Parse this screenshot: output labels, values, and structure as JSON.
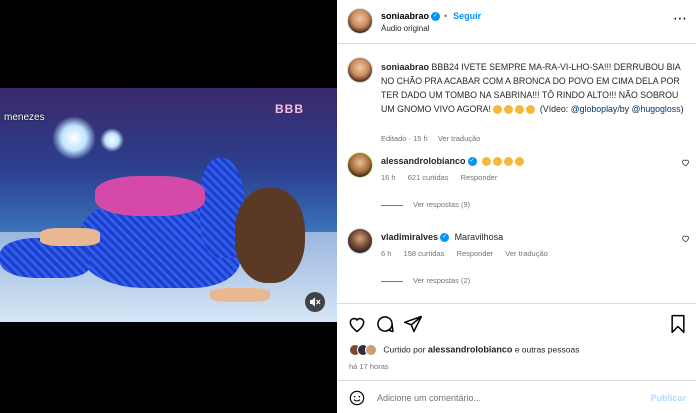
{
  "video": {
    "watermark_name": "menezes",
    "watermark_logo": "BBB"
  },
  "header": {
    "username": "soniaabrao",
    "follow_label": "Seguir",
    "subtitle": "Áudio original"
  },
  "caption": {
    "username": "soniaabrao",
    "text": "BBB24 IVETE SEMPRE MA-RA-VI-LHO-SA!!! DERRUBOU BIA NO CHÃO PRA ACABAR COM A BRONCA DO POVO EM CIMA DELA POR TER DADO UM TOMBO NA SABRINA!!! TÔ RINDO ALTO!!! NÃO SOBROU UM GNOMO VIVO AGORA!",
    "video_prefix": "(Vídeo:",
    "video_link1": "@globoplay",
    "video_mid": "/by",
    "video_link2": "@hugogloss",
    "video_suffix": ")",
    "edited": "Editado",
    "time": "15 h",
    "see_translation": "Ver tradução"
  },
  "comments": [
    {
      "username": "alessandrolobianco",
      "verified": true,
      "text": "",
      "emoji_count": 4,
      "time": "16 h",
      "likes": "621 curtidas",
      "reply": "Responder",
      "translation": "",
      "replies": "Ver respostas (9)"
    },
    {
      "username": "vladimiralves",
      "verified": true,
      "text": "Maravilhosa",
      "emoji_count": 0,
      "time": "6 h",
      "likes": "158 curtidas",
      "reply": "Responder",
      "translation": "Ver tradução",
      "replies": "Ver respostas (2)"
    }
  ],
  "likes_line": {
    "prefix": "Curtido por",
    "user": "alessandrolobianco",
    "suffix": "e outras pessoas"
  },
  "time_ago": "há 17 horas",
  "comment_input": {
    "placeholder": "Adicione um comentário...",
    "publish_label": "Publicar"
  },
  "colors": {
    "accent": "#0095f6",
    "publish_disabled": "#b3dbff",
    "muted_text": "#737373"
  }
}
